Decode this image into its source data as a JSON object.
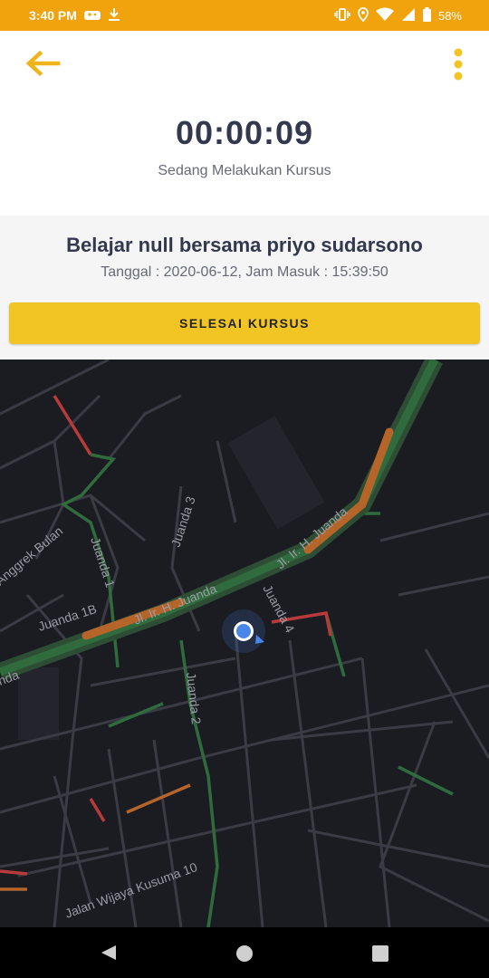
{
  "status_bar": {
    "time": "3:40 PM",
    "battery": "58%",
    "left_icons": [
      "gamepad-icon",
      "download-icon"
    ],
    "right_icons": [
      "vibrate-icon",
      "location-icon",
      "wifi-icon",
      "signal-icon",
      "battery-icon"
    ]
  },
  "header": {
    "back_icon": "arrow-left-icon",
    "menu_icon": "more-vertical-icon",
    "timer": "00:00:09",
    "subtitle": "Sedang Melakukan Kursus"
  },
  "course": {
    "title": "Belajar null bersama priyo sudarsono",
    "date_line": "Tanggal : 2020-06-12, Jam Masuk : 15:39:50",
    "finish_button": "SELESAI KURSUS"
  },
  "map": {
    "streets": {
      "juanda_main_1": "Jl. Ir. H. Juanda",
      "juanda_main_2": "Jl. Ir. H. Juanda",
      "juanda_edge": "nda",
      "juanda_1b": "Juanda 1B",
      "juanda_1": "Juanda 1",
      "juanda_2": "Juanda 2",
      "juanda_3": "Juanda 3",
      "juanda_4": "Juanda 4",
      "anggrek": "Anggrek Bulan",
      "wijaya": "Jalan Wijaya Kusuma 10"
    },
    "colors": {
      "road": "#3a3b44",
      "traffic_green": "#2f6b3c",
      "traffic_orange": "#b5652a",
      "traffic_red": "#b83a3a",
      "location_dot": "#4a86e8"
    }
  },
  "nav_bar": {
    "back_icon": "triangle-back-icon",
    "home_icon": "circle-home-icon",
    "recents_icon": "square-recents-icon"
  },
  "colors": {
    "accent": "#f0a30c",
    "button": "#f2c524",
    "title_text": "#34384f"
  }
}
